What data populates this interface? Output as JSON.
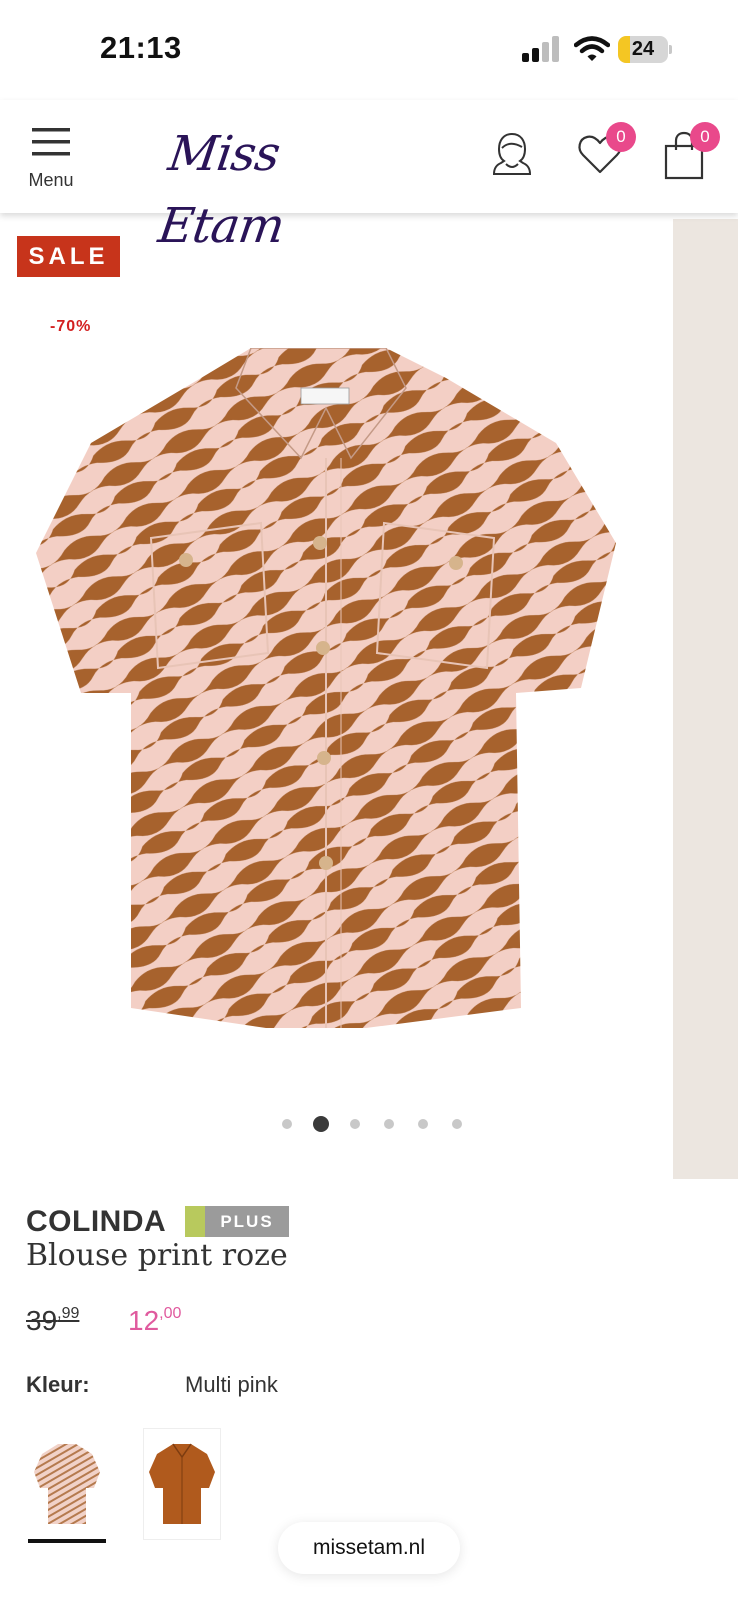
{
  "status_bar": {
    "time": "21:13",
    "battery": "24",
    "battery_level_percent": 24
  },
  "header": {
    "menu_label": "Menu",
    "logo_text": "Miss Etam",
    "wishlist_count": "0",
    "cart_count": "0",
    "icons": [
      "menu-icon",
      "account-icon",
      "heart-icon",
      "shopping-bag-icon"
    ]
  },
  "gallery": {
    "sale_label": "SALE",
    "discount": "-70%",
    "slide_count": 6,
    "active_slide": 2
  },
  "product": {
    "brand": "COLINDA",
    "size_badge": "PLUS",
    "name": "Blouse print roze",
    "old_price_main": "39",
    "old_price_cents": ",99",
    "new_price_main": "12",
    "new_price_cents": ",00",
    "color_label": "Kleur:",
    "color_value": "Multi pink",
    "swatches": [
      "Multi pink",
      "Brown"
    ]
  },
  "browser": {
    "url": "missetam.nl"
  },
  "colors": {
    "brand_purple": "#2a1458",
    "badge_pink": "#e9498b",
    "sale_red": "#c7341b",
    "new_price_pink": "#e05a9e",
    "plus_green": "#b8c95d"
  }
}
